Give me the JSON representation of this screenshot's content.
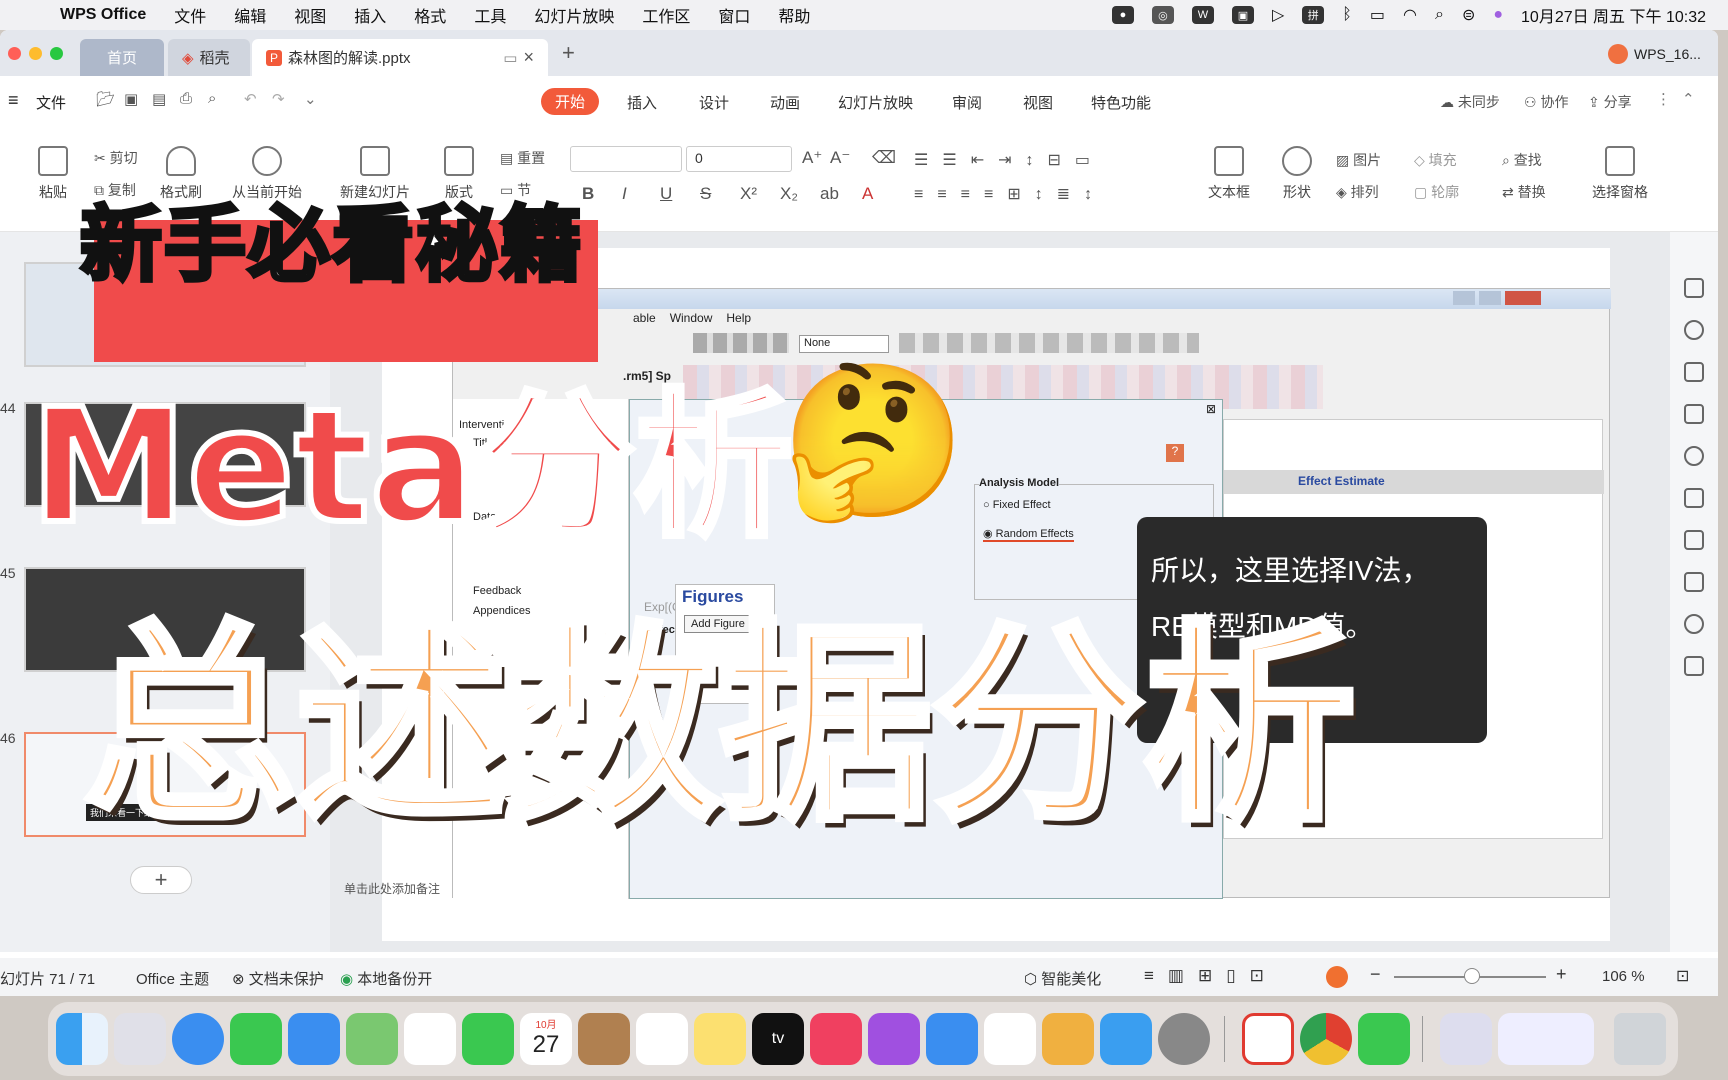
{
  "menubar": {
    "app": "WPS Office",
    "items": [
      "文件",
      "编辑",
      "视图",
      "插入",
      "格式",
      "工具",
      "幻灯片放映",
      "工作区",
      "窗口",
      "帮助"
    ],
    "datetime": "10月27日 周五 下午 10:32",
    "ime": "拼"
  },
  "tabs": {
    "home": "首页",
    "docer": "稻壳",
    "doc": "森林图的解读.pptx",
    "user": "WPS_16..."
  },
  "toolbar": {
    "file": "文件",
    "ribbon_tabs": [
      "开始",
      "插入",
      "设计",
      "动画",
      "幻灯片放映",
      "审阅",
      "视图",
      "特色功能"
    ],
    "sync": "未同步",
    "collab": "协作",
    "share": "分享"
  },
  "ribbon": {
    "paste": "粘贴",
    "cut": "剪切",
    "copy": "复制",
    "format_painter": "格式刷",
    "from_current": "从当前开始",
    "new_slide": "新建幻灯片",
    "layout": "版式",
    "reset": "重置",
    "section": "节",
    "font_size": "0",
    "textbox": "文本框",
    "shape": "形状",
    "picture": "图片",
    "arrange": "排列",
    "fill": "填充",
    "outline": "轮廓",
    "find": "查找",
    "replace": "替换",
    "select_pane": "选择窗格"
  },
  "thumbnails": [
    {
      "num": "44"
    },
    {
      "num": "45"
    },
    {
      "num": "46",
      "caption": "我们来看一下结果部分。"
    }
  ],
  "slide": {
    "editor_menu": [
      "able",
      "Window",
      "Help"
    ],
    "style_value": "None",
    "file_label": ".rm5] Sp",
    "nav_items": [
      "Interventi",
      "Title",
      "Data",
      "Feedback",
      "Appendices"
    ],
    "figures": "Figures",
    "add_figure": "Add Figure",
    "analysis_model": "Analysis Model",
    "fixed_effect": "Fixed Effect",
    "random_effects": "Random Effects",
    "effect_estimate": "Effect Estimate",
    "effect_measure": "Effect Measure",
    "expo": "Exp[(O-E) / Var]",
    "note_line1": "所以，这里选择IV法，",
    "note_line2": "RE模型和MD值。"
  },
  "overlay": {
    "banner": "新手必看秘籍",
    "meta": "Meta分析",
    "emoji": "🤔",
    "main": "总述数据分析"
  },
  "notes_hint": "单击此处添加备注",
  "statusbar": {
    "slide_count": "幻灯片 71 / 71",
    "theme": "Office 主题",
    "protect": "文档未保护",
    "backup": "本地备份开",
    "beautify": "智能美化",
    "zoom": "106 %"
  },
  "dock": {
    "calendar_month": "10月",
    "calendar_day": "27",
    "tv": "tv"
  },
  "colors": {
    "accent": "#f25a3a",
    "banner_red": "#f04b4b",
    "orange_text": "#f5a052"
  }
}
